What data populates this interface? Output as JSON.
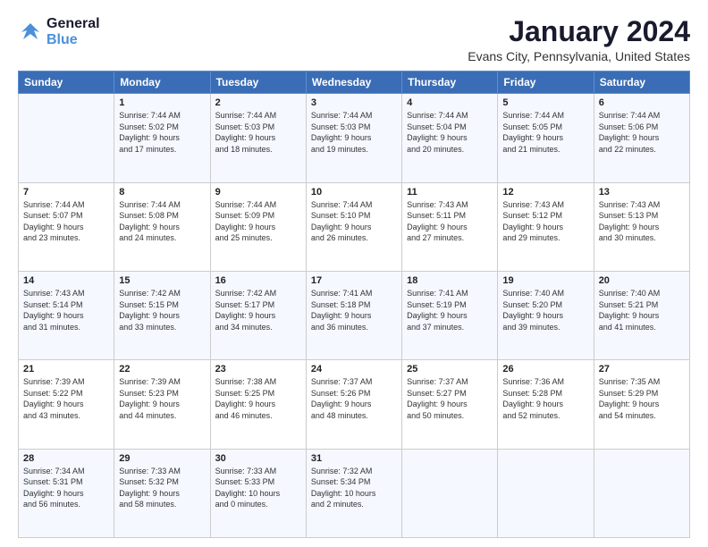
{
  "header": {
    "logo_line1": "General",
    "logo_line2": "Blue",
    "month": "January 2024",
    "location": "Evans City, Pennsylvania, United States"
  },
  "weekdays": [
    "Sunday",
    "Monday",
    "Tuesday",
    "Wednesday",
    "Thursday",
    "Friday",
    "Saturday"
  ],
  "weeks": [
    [
      {
        "day": "",
        "info": ""
      },
      {
        "day": "1",
        "info": "Sunrise: 7:44 AM\nSunset: 5:02 PM\nDaylight: 9 hours\nand 17 minutes."
      },
      {
        "day": "2",
        "info": "Sunrise: 7:44 AM\nSunset: 5:03 PM\nDaylight: 9 hours\nand 18 minutes."
      },
      {
        "day": "3",
        "info": "Sunrise: 7:44 AM\nSunset: 5:03 PM\nDaylight: 9 hours\nand 19 minutes."
      },
      {
        "day": "4",
        "info": "Sunrise: 7:44 AM\nSunset: 5:04 PM\nDaylight: 9 hours\nand 20 minutes."
      },
      {
        "day": "5",
        "info": "Sunrise: 7:44 AM\nSunset: 5:05 PM\nDaylight: 9 hours\nand 21 minutes."
      },
      {
        "day": "6",
        "info": "Sunrise: 7:44 AM\nSunset: 5:06 PM\nDaylight: 9 hours\nand 22 minutes."
      }
    ],
    [
      {
        "day": "7",
        "info": "Sunrise: 7:44 AM\nSunset: 5:07 PM\nDaylight: 9 hours\nand 23 minutes."
      },
      {
        "day": "8",
        "info": "Sunrise: 7:44 AM\nSunset: 5:08 PM\nDaylight: 9 hours\nand 24 minutes."
      },
      {
        "day": "9",
        "info": "Sunrise: 7:44 AM\nSunset: 5:09 PM\nDaylight: 9 hours\nand 25 minutes."
      },
      {
        "day": "10",
        "info": "Sunrise: 7:44 AM\nSunset: 5:10 PM\nDaylight: 9 hours\nand 26 minutes."
      },
      {
        "day": "11",
        "info": "Sunrise: 7:43 AM\nSunset: 5:11 PM\nDaylight: 9 hours\nand 27 minutes."
      },
      {
        "day": "12",
        "info": "Sunrise: 7:43 AM\nSunset: 5:12 PM\nDaylight: 9 hours\nand 29 minutes."
      },
      {
        "day": "13",
        "info": "Sunrise: 7:43 AM\nSunset: 5:13 PM\nDaylight: 9 hours\nand 30 minutes."
      }
    ],
    [
      {
        "day": "14",
        "info": "Sunrise: 7:43 AM\nSunset: 5:14 PM\nDaylight: 9 hours\nand 31 minutes."
      },
      {
        "day": "15",
        "info": "Sunrise: 7:42 AM\nSunset: 5:15 PM\nDaylight: 9 hours\nand 33 minutes."
      },
      {
        "day": "16",
        "info": "Sunrise: 7:42 AM\nSunset: 5:17 PM\nDaylight: 9 hours\nand 34 minutes."
      },
      {
        "day": "17",
        "info": "Sunrise: 7:41 AM\nSunset: 5:18 PM\nDaylight: 9 hours\nand 36 minutes."
      },
      {
        "day": "18",
        "info": "Sunrise: 7:41 AM\nSunset: 5:19 PM\nDaylight: 9 hours\nand 37 minutes."
      },
      {
        "day": "19",
        "info": "Sunrise: 7:40 AM\nSunset: 5:20 PM\nDaylight: 9 hours\nand 39 minutes."
      },
      {
        "day": "20",
        "info": "Sunrise: 7:40 AM\nSunset: 5:21 PM\nDaylight: 9 hours\nand 41 minutes."
      }
    ],
    [
      {
        "day": "21",
        "info": "Sunrise: 7:39 AM\nSunset: 5:22 PM\nDaylight: 9 hours\nand 43 minutes."
      },
      {
        "day": "22",
        "info": "Sunrise: 7:39 AM\nSunset: 5:23 PM\nDaylight: 9 hours\nand 44 minutes."
      },
      {
        "day": "23",
        "info": "Sunrise: 7:38 AM\nSunset: 5:25 PM\nDaylight: 9 hours\nand 46 minutes."
      },
      {
        "day": "24",
        "info": "Sunrise: 7:37 AM\nSunset: 5:26 PM\nDaylight: 9 hours\nand 48 minutes."
      },
      {
        "day": "25",
        "info": "Sunrise: 7:37 AM\nSunset: 5:27 PM\nDaylight: 9 hours\nand 50 minutes."
      },
      {
        "day": "26",
        "info": "Sunrise: 7:36 AM\nSunset: 5:28 PM\nDaylight: 9 hours\nand 52 minutes."
      },
      {
        "day": "27",
        "info": "Sunrise: 7:35 AM\nSunset: 5:29 PM\nDaylight: 9 hours\nand 54 minutes."
      }
    ],
    [
      {
        "day": "28",
        "info": "Sunrise: 7:34 AM\nSunset: 5:31 PM\nDaylight: 9 hours\nand 56 minutes."
      },
      {
        "day": "29",
        "info": "Sunrise: 7:33 AM\nSunset: 5:32 PM\nDaylight: 9 hours\nand 58 minutes."
      },
      {
        "day": "30",
        "info": "Sunrise: 7:33 AM\nSunset: 5:33 PM\nDaylight: 10 hours\nand 0 minutes."
      },
      {
        "day": "31",
        "info": "Sunrise: 7:32 AM\nSunset: 5:34 PM\nDaylight: 10 hours\nand 2 minutes."
      },
      {
        "day": "",
        "info": ""
      },
      {
        "day": "",
        "info": ""
      },
      {
        "day": "",
        "info": ""
      }
    ]
  ]
}
